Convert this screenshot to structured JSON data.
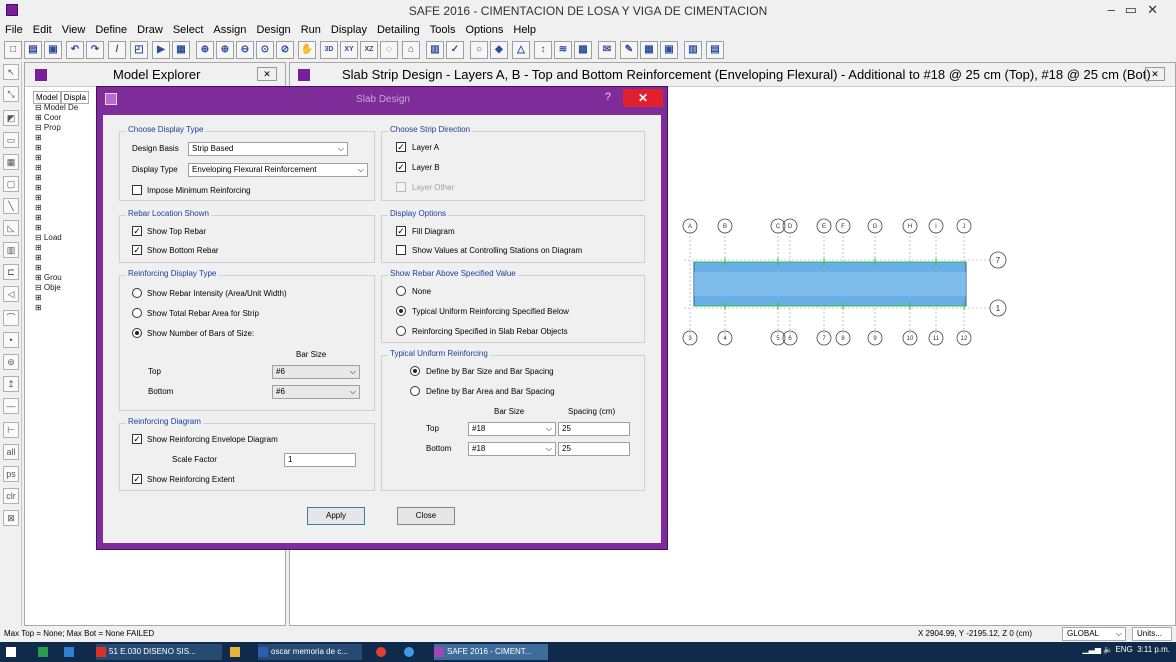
{
  "window": {
    "title": "SAFE 2016 - CIMENTACION DE LOSA Y VIGA DE CIMENTACION"
  },
  "menu": [
    "File",
    "Edit",
    "View",
    "Define",
    "Draw",
    "Select",
    "Assign",
    "Design",
    "Run",
    "Display",
    "Detailing",
    "Tools",
    "Options",
    "Help"
  ],
  "toolbar": {
    "icons": [
      "new-icon",
      "open-icon",
      "save-icon",
      "undo-icon",
      "redo-icon",
      "pencil-icon",
      "refresh-icon",
      "run-icon",
      "lock-icon",
      "zoom-window-icon",
      "zoom-in-icon",
      "zoom-out-icon",
      "zoom-fit-icon",
      "zoom-prev-icon",
      "pan-icon",
      "3d-view-icon",
      "xy-view-icon",
      "xz-view-icon",
      "perspective-icon",
      "section-icon",
      "object-shrink-icon",
      "check-icon",
      "circle-icon",
      "shade-icon",
      "warning-icon",
      "display-icon",
      "layers-icon",
      "stress-icon",
      "link-icon",
      "edit-icon",
      "table-icon",
      "grid-icon",
      "chart-icon"
    ],
    "labels": {
      "3d": "3D",
      "xy": "XY",
      "xz": "XZ"
    }
  },
  "explorer": {
    "title": "Model Explorer",
    "close": "✕",
    "tabs": [
      "Model",
      "Displa"
    ],
    "tree": [
      "⊟ Model De",
      "  ⊞ Coor",
      "  ⊟ Prop",
      "     ⊞",
      "     ⊞",
      "     ⊞",
      "     ⊞",
      "     ⊞",
      "     ⊞",
      "     ⊞",
      "     ⊞",
      "     ⊞",
      "     ⊞",
      "  ⊟ Load",
      "     ⊞",
      "     ⊞",
      "     ⊞",
      "  ⊞ Grou",
      "  ⊟ Obje",
      "     ⊞",
      "     ⊞",
      "",
      "",
      "     ⊞",
      "     ⊞"
    ]
  },
  "main": {
    "title": "Slab Strip Design - Layers A, B - Top and Bottom Reinforcement (Enveloping Flexural)  - Additional to #18 @ 25 cm (Top), #18 @ 25 cm (Bot)",
    "close": "✕",
    "grid_top": [
      "A",
      "B",
      "C",
      "D",
      "E",
      "F",
      "G",
      "H",
      "I",
      "J"
    ],
    "grid_bottom": [
      "3",
      "4",
      "5",
      "6",
      "7",
      "8",
      "9",
      "10",
      "11",
      "12"
    ],
    "grid_right_top": "7",
    "grid_right_bottom": "1"
  },
  "dialog": {
    "title": "Slab Design",
    "help": "?",
    "close": "✕",
    "display_type": {
      "label": "Choose Display Type",
      "design_basis_label": "Design Basis",
      "design_basis_value": "Strip Based",
      "display_type_label": "Display Type",
      "display_type_value": "Enveloping Flexural Reinforcement",
      "impose_min": "Impose Minimum Reinforcing"
    },
    "strip_direction": {
      "label": "Choose Strip Direction",
      "layer_a": "Layer A",
      "layer_b": "Layer B",
      "layer_other": "Layer Other"
    },
    "rebar_location": {
      "label": "Rebar Location Shown",
      "show_top": "Show Top Rebar",
      "show_bottom": "Show Bottom Rebar"
    },
    "display_options": {
      "label": "Display Options",
      "fill": "Fill Diagram",
      "show_values": "Show Values at Controlling Stations on Diagram"
    },
    "reinforcing_display": {
      "label": "Reinforcing Display Type",
      "opt1": "Show Rebar Intensity (Area/Unit Width)",
      "opt2": "Show Total Rebar Area for Strip",
      "opt3": "Show Number of Bars of Size:",
      "bar_size_header": "Bar Size",
      "top_label": "Top",
      "top_value": "#6",
      "bottom_label": "Bottom",
      "bottom_value": "#6"
    },
    "show_rebar_above": {
      "label": "Show Rebar Above Specified Value",
      "none": "None",
      "typical": "Typical Uniform Reinforcing Specified Below",
      "objects": "Reinforcing Specified in Slab Rebar Objects"
    },
    "typical_uniform": {
      "label": "Typical Uniform Reinforcing",
      "opt1": "Define by Bar Size and Bar Spacing",
      "opt2": "Define by Bar Area and Bar Spacing",
      "bar_size_header": "Bar Size",
      "spacing_header": "Spacing  (cm)",
      "top_label": "Top",
      "top_size": "#18",
      "top_spacing": "25",
      "bottom_label": "Bottom",
      "bottom_size": "#18",
      "bottom_spacing": "25"
    },
    "reinforcing_diagram": {
      "label": "Reinforcing Diagram",
      "envelope": "Show Reinforcing Envelope Diagram",
      "scale_label": "Scale Factor",
      "scale_value": "1",
      "extent": "Show Reinforcing Extent"
    },
    "apply": "Apply",
    "close_btn": "Close"
  },
  "status": {
    "left": "Max Top = None;  Max Bot = None  FAILED",
    "coords": "X 2904.99,  Y -2195.12,  Z 0  (cm)",
    "global": "GLOBAL",
    "units": "Units..."
  },
  "taskbar": {
    "items": [
      "51 E.030 DISENO SIS...",
      "oscar memoria de c...",
      "SAFE 2016 - CIMENT..."
    ],
    "lang": "ENG",
    "time": "3:11 p.m."
  },
  "colors": {
    "dialog_frame": "#7d2c9a",
    "group_label": "#1a3e9c",
    "close_red": "#e0202a",
    "strip_fill": "#6aaee6"
  }
}
